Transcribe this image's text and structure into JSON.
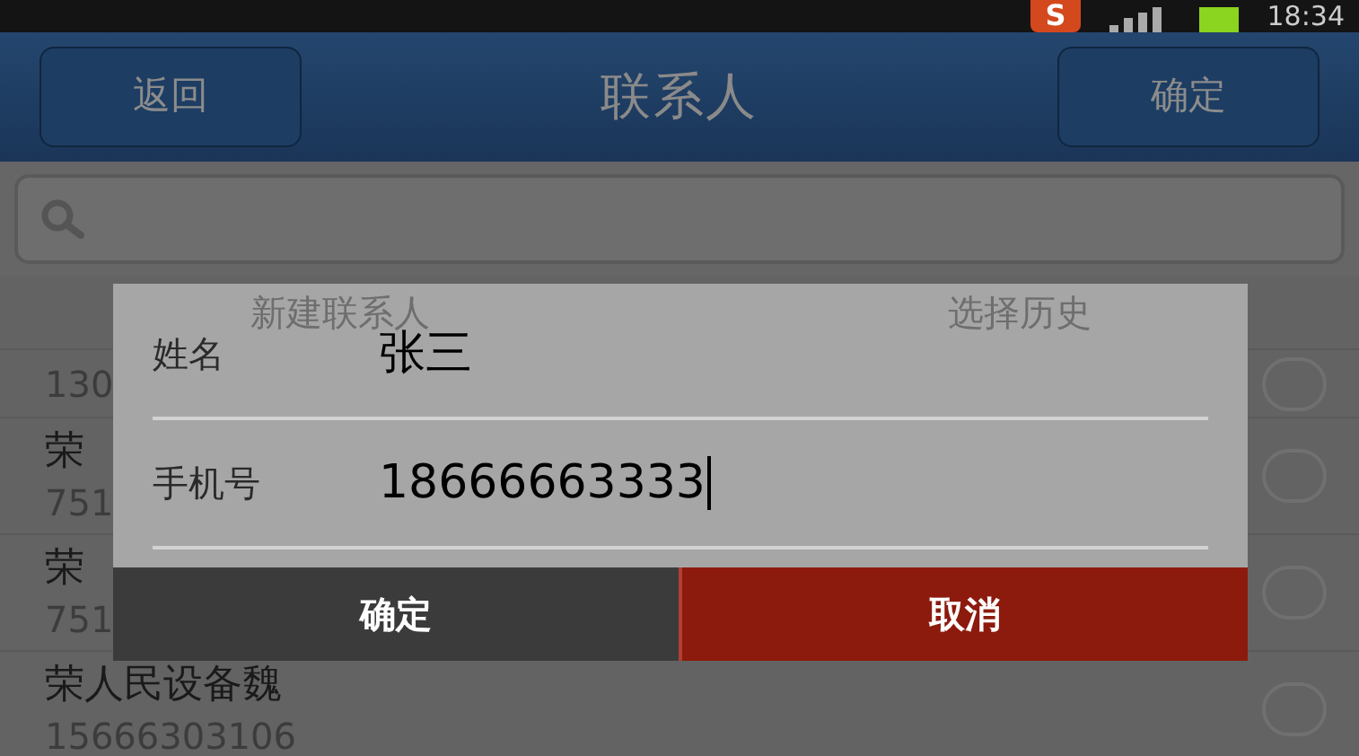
{
  "status_bar": {
    "time": "18:34",
    "app_badge": "S"
  },
  "header": {
    "back": "返回",
    "title": "联系人",
    "confirm": "确定"
  },
  "tabs": [
    {
      "label": "新建联系人"
    },
    {
      "label": "选择历史"
    }
  ],
  "contacts": [
    {
      "phone": "130",
      "checked": false
    },
    {
      "name": "荣",
      "phone": "751",
      "checked": false
    },
    {
      "name": "荣",
      "phone": "751",
      "checked": false
    },
    {
      "name": "荣人民设备魏",
      "phone": "15666303106",
      "checked": false
    }
  ],
  "dialog": {
    "fields": [
      {
        "label": "姓名",
        "value": "张三"
      },
      {
        "label": "手机号",
        "value": "18666663333",
        "focused": true
      }
    ],
    "buttons": [
      {
        "label": "确定",
        "kind": "confirm"
      },
      {
        "label": "取消",
        "kind": "cancel"
      }
    ]
  }
}
